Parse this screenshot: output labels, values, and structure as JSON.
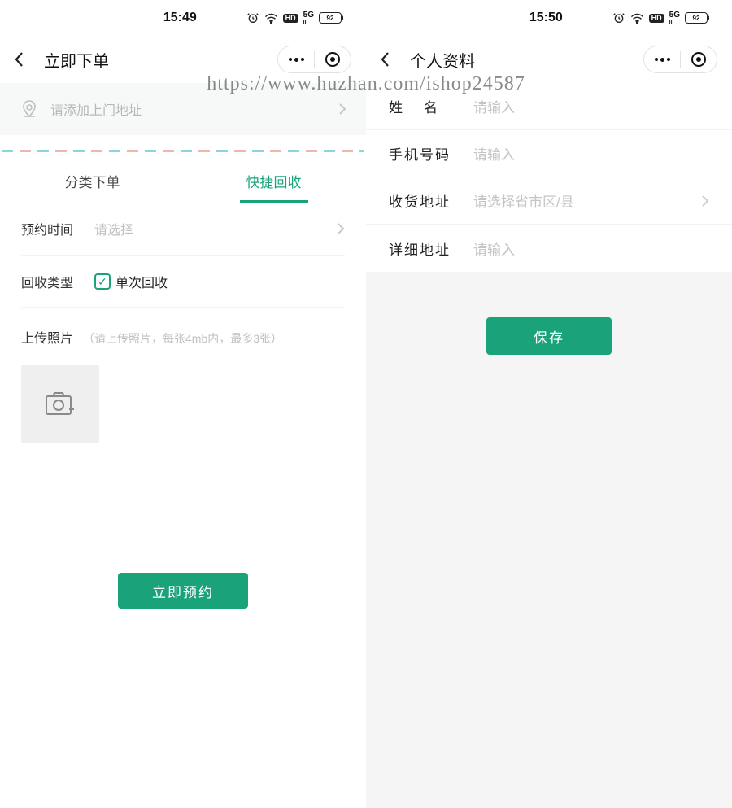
{
  "watermark_text": "https://www.huzhan.com/ishop24587",
  "left": {
    "status_time": "15:49",
    "battery": "92",
    "nav_title": "立即下单",
    "address_placeholder": "请添加上门地址",
    "tabs": {
      "category": "分类下单",
      "quick": "快捷回收"
    },
    "appointment": {
      "label": "预约时间",
      "placeholder": "请选择"
    },
    "recycle_type": {
      "label": "回收类型",
      "option": "单次回收"
    },
    "upload": {
      "label": "上传照片",
      "hint": "（请上传照片，每张4mb内，最多3张）"
    },
    "submit_label": "立即预约"
  },
  "right": {
    "status_time": "15:50",
    "battery": "92",
    "nav_title": "个人资料",
    "fields": {
      "name_label": "姓名",
      "name_placeholder": "请输入",
      "phone_label": "手机号码",
      "phone_placeholder": "请输入",
      "addr_label": "收货地址",
      "addr_placeholder": "请选择省市区/县",
      "detail_label": "详细地址",
      "detail_placeholder": "请输入"
    },
    "save_label": "保存"
  }
}
